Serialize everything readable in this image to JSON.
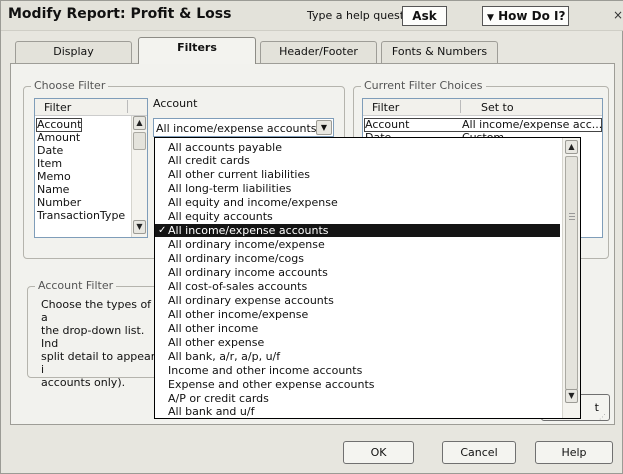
{
  "window": {
    "title": "Modify Report: Profit & Loss",
    "help_label": "Type a help question",
    "ask_label": "Ask",
    "howdo_label": "How Do I?",
    "close_glyph": "×"
  },
  "tabs": [
    {
      "label": "Display",
      "active": false
    },
    {
      "label": "Filters",
      "active": true
    },
    {
      "label": "Header/Footer",
      "active": false
    },
    {
      "label": "Fonts & Numbers",
      "active": false
    }
  ],
  "choose_filter": {
    "group_label": "Choose Filter",
    "column_header": "Filter",
    "items": [
      "Account",
      "Amount",
      "Date",
      "Item",
      "Memo",
      "Name",
      "Number",
      "TransactionType"
    ],
    "selected_index": 0
  },
  "account_field": {
    "label": "Account",
    "value": "All income/expense accounts"
  },
  "current_filters": {
    "group_label": "Current Filter Choices",
    "columns": [
      "Filter",
      "Set to"
    ],
    "rows": [
      {
        "filter": "Account",
        "set_to": "All income/expense acc..."
      },
      {
        "filter": "Date",
        "set_to": "Custom"
      }
    ]
  },
  "account_filter": {
    "group_label": "Account Filter",
    "description_lines": [
      "Choose the types of a",
      "the drop-down list. Ind",
      "split detail to appear i",
      "accounts only)."
    ]
  },
  "dropdown": {
    "items": [
      "All accounts payable",
      "All credit cards",
      "All other current liabilities",
      "All long-term liabilities",
      "All equity and income/expense",
      "All equity accounts",
      "All income/expense accounts",
      "All ordinary income/expense",
      "All ordinary income/cogs",
      "All ordinary income accounts",
      "All cost-of-sales accounts",
      "All ordinary expense accounts",
      "All other income/expense",
      "All other income",
      "All other expense",
      "All bank, a/r, a/p, u/f",
      "Income and other income accounts",
      "Expense and other expense accounts",
      "A/P or credit cards",
      "All bank and u/f"
    ],
    "selected_index": 6,
    "check_glyph": "✓"
  },
  "partial_button_text": "t",
  "buttons": {
    "ok": "OK",
    "cancel": "Cancel",
    "help": "Help"
  }
}
